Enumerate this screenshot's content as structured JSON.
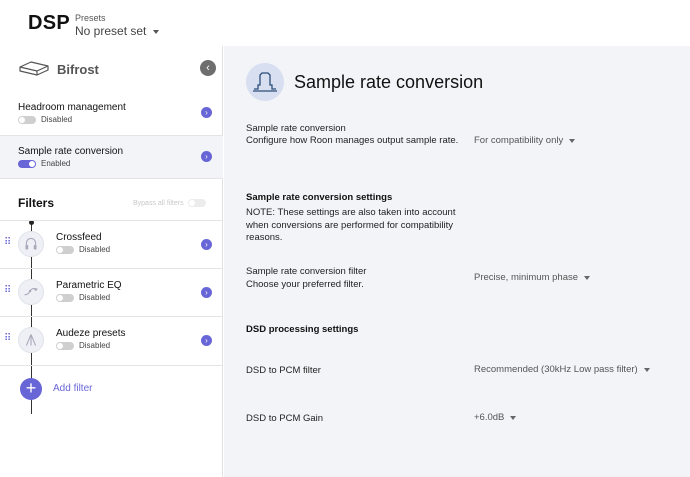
{
  "header": {
    "title": "DSP",
    "presets_label": "Presets",
    "presets_value": "No preset set"
  },
  "sidebar": {
    "device_name": "Bifrost",
    "items": [
      {
        "label": "Headroom management",
        "status": "Disabled",
        "enabled": false
      },
      {
        "label": "Sample rate conversion",
        "status": "Enabled",
        "enabled": true
      }
    ],
    "filters_title": "Filters",
    "bypass_label": "Bypass all filters",
    "filters": [
      {
        "label": "Crossfeed",
        "status": "Disabled",
        "enabled": false
      },
      {
        "label": "Parametric EQ",
        "status": "Disabled",
        "enabled": false
      },
      {
        "label": "Audeze presets",
        "status": "Disabled",
        "enabled": false
      }
    ],
    "add_filter_label": "Add filter"
  },
  "main": {
    "title": "Sample rate conversion",
    "src_title": "Sample rate conversion",
    "src_desc": "Configure how Roon manages output sample rate.",
    "src_value": "For compatibility only",
    "settings_heading": "Sample rate conversion settings",
    "settings_note": "NOTE: These settings are also taken into account when conversions are performed for compatibility reasons.",
    "filter_title": "Sample rate conversion filter",
    "filter_desc": "Choose your preferred filter.",
    "filter_value": "Precise, minimum phase",
    "dsd_heading": "DSD processing settings",
    "dsd_filter_label": "DSD to PCM filter",
    "dsd_filter_value": "Recommended (30kHz Low pass filter)",
    "dsd_gain_label": "DSD to PCM Gain",
    "dsd_gain_value": "+6.0dB"
  },
  "colors": {
    "accent": "#6866d6",
    "main_bg": "#f3f4f8"
  }
}
